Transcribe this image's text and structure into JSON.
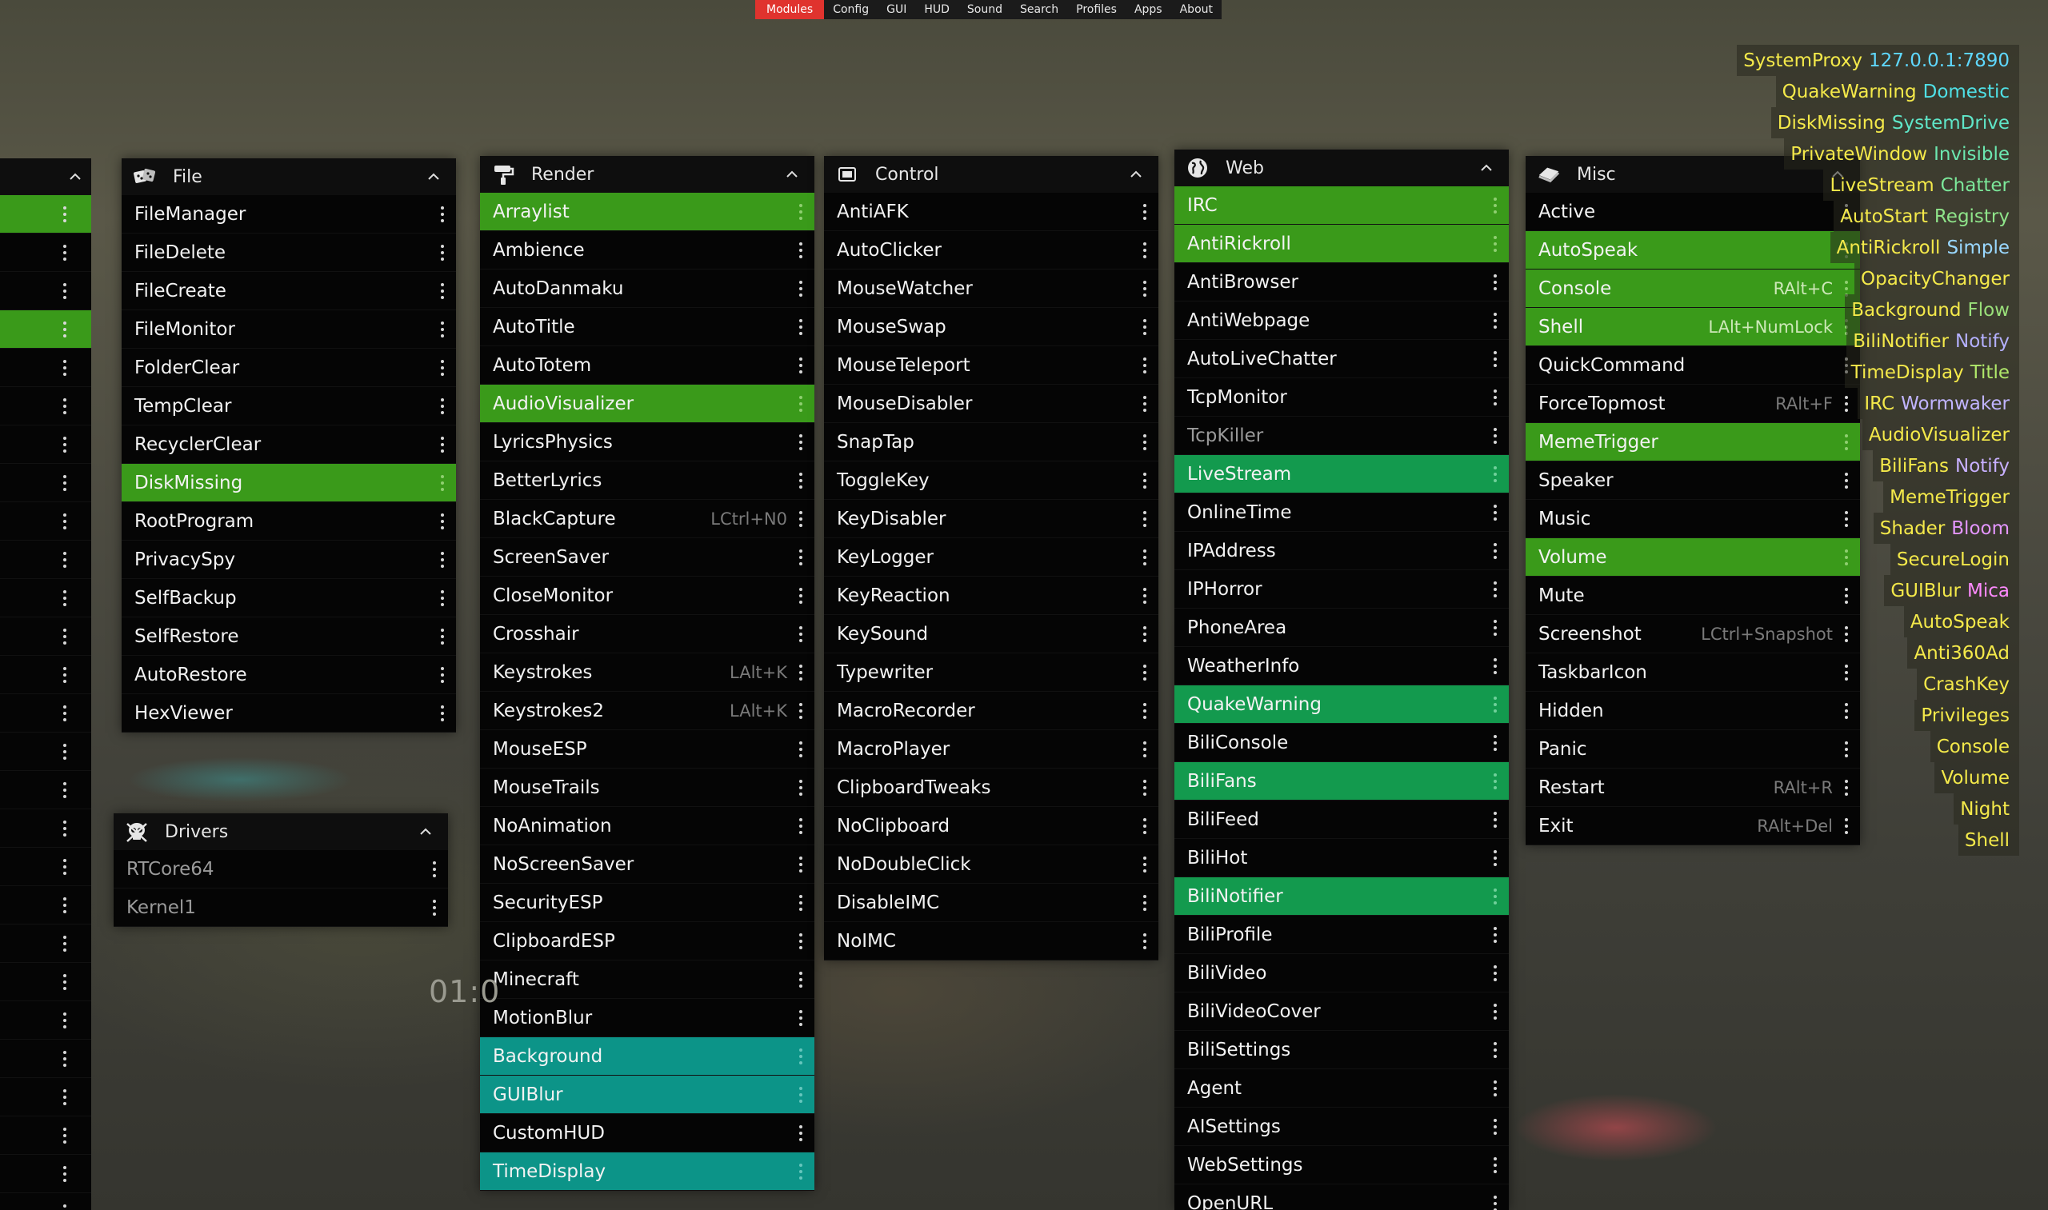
{
  "nav": [
    "Modules",
    "Config",
    "GUI",
    "HUD",
    "Sound",
    "Search",
    "Profiles",
    "Apps",
    "About"
  ],
  "nav_active": 0,
  "clock": "01:0",
  "panels": {
    "file": {
      "title": "File",
      "items": [
        {
          "label": "FileManager"
        },
        {
          "label": "FileDelete"
        },
        {
          "label": "FileCreate"
        },
        {
          "label": "FileMonitor"
        },
        {
          "label": "FolderClear"
        },
        {
          "label": "TempClear"
        },
        {
          "label": "RecyclerClear"
        },
        {
          "label": "DiskMissing",
          "state": "on"
        },
        {
          "label": "RootProgram"
        },
        {
          "label": "PrivacySpy"
        },
        {
          "label": "SelfBackup"
        },
        {
          "label": "SelfRestore"
        },
        {
          "label": "AutoRestore"
        },
        {
          "label": "HexViewer"
        }
      ]
    },
    "drivers": {
      "title": "Drivers",
      "items": [
        {
          "label": "RTCore64",
          "state": "dim"
        },
        {
          "label": "Kernel1",
          "state": "dim"
        }
      ]
    },
    "render": {
      "title": "Render",
      "items": [
        {
          "label": "Arraylist",
          "state": "on"
        },
        {
          "label": "Ambience"
        },
        {
          "label": "AutoDanmaku"
        },
        {
          "label": "AutoTitle"
        },
        {
          "label": "AutoTotem"
        },
        {
          "label": "AudioVisualizer",
          "state": "on"
        },
        {
          "label": "LyricsPhysics"
        },
        {
          "label": "BetterLyrics"
        },
        {
          "label": "BlackCapture",
          "key": "LCtrl+N0"
        },
        {
          "label": "ScreenSaver"
        },
        {
          "label": "CloseMonitor"
        },
        {
          "label": "Crosshair"
        },
        {
          "label": "Keystrokes",
          "key": "LAlt+K"
        },
        {
          "label": "Keystrokes2",
          "key": "LAlt+K"
        },
        {
          "label": "MouseESP"
        },
        {
          "label": "MouseTrails"
        },
        {
          "label": "NoAnimation"
        },
        {
          "label": "NoScreenSaver"
        },
        {
          "label": "SecurityESP"
        },
        {
          "label": "ClipboardESP"
        },
        {
          "label": "Minecraft"
        },
        {
          "label": "MotionBlur"
        },
        {
          "label": "Background",
          "state": "teal"
        },
        {
          "label": "GUIBlur",
          "state": "teal"
        },
        {
          "label": "CustomHUD"
        },
        {
          "label": "TimeDisplay",
          "state": "teal"
        }
      ]
    },
    "control": {
      "title": "Control",
      "items": [
        {
          "label": "AntiAFK"
        },
        {
          "label": "AutoClicker"
        },
        {
          "label": "MouseWatcher"
        },
        {
          "label": "MouseSwap"
        },
        {
          "label": "MouseTeleport"
        },
        {
          "label": "MouseDisabler"
        },
        {
          "label": "SnapTap"
        },
        {
          "label": "ToggleKey"
        },
        {
          "label": "KeyDisabler"
        },
        {
          "label": "KeyLogger"
        },
        {
          "label": "KeyReaction"
        },
        {
          "label": "KeySound"
        },
        {
          "label": "Typewriter"
        },
        {
          "label": "MacroRecorder"
        },
        {
          "label": "MacroPlayer"
        },
        {
          "label": "ClipboardTweaks"
        },
        {
          "label": "NoClipboard"
        },
        {
          "label": "NoDoubleClick"
        },
        {
          "label": "DisableIMC"
        },
        {
          "label": "NoIMC"
        }
      ]
    },
    "web": {
      "title": "Web",
      "items": [
        {
          "label": "IRC",
          "state": "on"
        },
        {
          "label": "AntiRickroll",
          "state": "on"
        },
        {
          "label": "AntiBrowser"
        },
        {
          "label": "AntiWebpage"
        },
        {
          "label": "AutoLiveChatter"
        },
        {
          "label": "TcpMonitor"
        },
        {
          "label": "TcpKiller",
          "state": "dim"
        },
        {
          "label": "LiveStream",
          "state": "web-on"
        },
        {
          "label": "OnlineTime"
        },
        {
          "label": "IPAddress"
        },
        {
          "label": "IPHorror"
        },
        {
          "label": "PhoneArea"
        },
        {
          "label": "WeatherInfo"
        },
        {
          "label": "QuakeWarning",
          "state": "web-on"
        },
        {
          "label": "BiliConsole"
        },
        {
          "label": "BiliFans",
          "state": "web-on"
        },
        {
          "label": "BiliFeed"
        },
        {
          "label": "BiliHot"
        },
        {
          "label": "BiliNotifier",
          "state": "web-on"
        },
        {
          "label": "BiliProfile"
        },
        {
          "label": "BiliVideo"
        },
        {
          "label": "BiliVideoCover"
        },
        {
          "label": "BiliSettings"
        },
        {
          "label": "Agent"
        },
        {
          "label": "AISettings"
        },
        {
          "label": "WebSettings"
        },
        {
          "label": "OpenURL"
        }
      ]
    },
    "misc": {
      "title": "Misc",
      "items": [
        {
          "label": "Active"
        },
        {
          "label": "AutoSpeak",
          "state": "on"
        },
        {
          "label": "Console",
          "state": "on",
          "key": "RAlt+C"
        },
        {
          "label": "Shell",
          "state": "on",
          "key": "LAlt+NumLock"
        },
        {
          "label": "QuickCommand"
        },
        {
          "label": "ForceTopmost",
          "key": "RAlt+F"
        },
        {
          "label": "MemeTrigger",
          "state": "on"
        },
        {
          "label": "Speaker"
        },
        {
          "label": "Music"
        },
        {
          "label": "Volume",
          "state": "on"
        },
        {
          "label": "Mute"
        },
        {
          "label": "Screenshot",
          "key": "LCtrl+Snapshot"
        },
        {
          "label": "TaskbarIcon"
        },
        {
          "label": "Hidden"
        },
        {
          "label": "Panic"
        },
        {
          "label": "Restart",
          "key": "RAlt+R"
        },
        {
          "label": "Exit",
          "key": "RAlt+Del"
        }
      ]
    }
  },
  "left_strip_on_rows": [
    0,
    3
  ],
  "hud": [
    {
      "name": "SystemProxy",
      "tag": "127.0.0.1:7890",
      "color": "#5fd8ff"
    },
    {
      "name": "QuakeWarning",
      "tag": "Domestic",
      "color": "#4fe0e6"
    },
    {
      "name": "DiskMissing",
      "tag": "SystemDrive",
      "color": "#5fe6c8"
    },
    {
      "name": "PrivateWindow",
      "tag": "Invisible",
      "color": "#6ce8b0"
    },
    {
      "name": "LiveStream",
      "tag": "Chatter",
      "color": "#7ce89a"
    },
    {
      "name": "AutoStart",
      "tag": "Registry",
      "color": "#8fe48a"
    },
    {
      "name": "AntiRickroll",
      "tag": "Simple",
      "color": "#9ad8ff"
    },
    {
      "name": "OpacityChanger",
      "tag": "",
      "color": ""
    },
    {
      "name": "Background",
      "tag": "Flow",
      "color": "#9ae07a"
    },
    {
      "name": "BiliNotifier",
      "tag": "Notify",
      "color": "#b4b0ff"
    },
    {
      "name": "TimeDisplay",
      "tag": "Title",
      "color": "#b0e86a"
    },
    {
      "name": "IRC",
      "tag": "Wormwaker",
      "color": "#c0b4ff"
    },
    {
      "name": "AudioVisualizer",
      "tag": "",
      "color": ""
    },
    {
      "name": "BiliFans",
      "tag": "Notify",
      "color": "#c8b0ff"
    },
    {
      "name": "MemeTrigger",
      "tag": "",
      "color": ""
    },
    {
      "name": "Shader",
      "tag": "Bloom",
      "color": "#e496ff"
    },
    {
      "name": "SecureLogin",
      "tag": "",
      "color": ""
    },
    {
      "name": "GUIBlur",
      "tag": "Mica",
      "color": "#ff8aff"
    },
    {
      "name": "AutoSpeak",
      "tag": "",
      "color": ""
    },
    {
      "name": "Anti360Ad",
      "tag": "",
      "color": ""
    },
    {
      "name": "CrashKey",
      "tag": "",
      "color": ""
    },
    {
      "name": "Privileges",
      "tag": "",
      "color": ""
    },
    {
      "name": "Console",
      "tag": "",
      "color": ""
    },
    {
      "name": "Volume",
      "tag": "",
      "color": ""
    },
    {
      "name": "Night",
      "tag": "",
      "color": ""
    },
    {
      "name": "Shell",
      "tag": "",
      "color": ""
    }
  ]
}
